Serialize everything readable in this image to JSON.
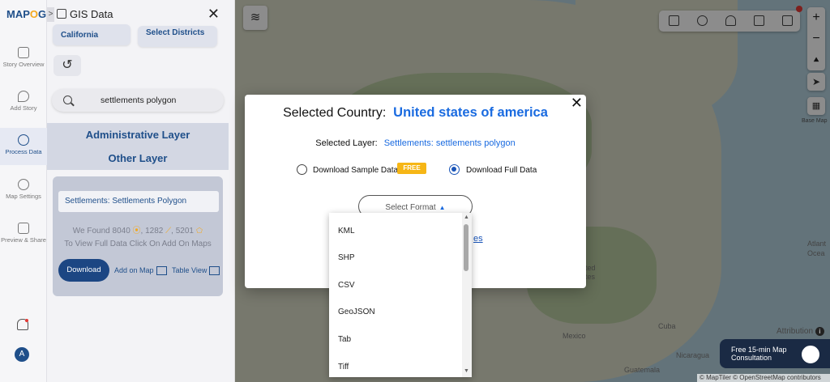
{
  "app": {
    "logo_left": "MAP",
    "logo_o": "O",
    "logo_right": "G",
    "panel_title": "GIS Data",
    "panel_toggle": ">",
    "close_glyph": "✕"
  },
  "rail": {
    "items": [
      {
        "label": "Story Overview",
        "icon": "book-icon"
      },
      {
        "label": "Add Story",
        "icon": "pin-icon"
      },
      {
        "label": "Process Data",
        "icon": "gear-icon"
      },
      {
        "label": "Map Settings",
        "icon": "settings-icon"
      },
      {
        "label": "Preview & Share",
        "icon": "share-icon"
      }
    ],
    "avatar": "A"
  },
  "panel": {
    "chip_state": "California",
    "chip_district": "Select Districts",
    "reset_glyph": "↺",
    "search_value": "settlements polygon",
    "layer_admin": "Administrative Layer",
    "layer_other": "Other Layer",
    "result_name": "Settlements: Settlements Polygon",
    "stats_a": "We Found  8040",
    "stats_b": "1282",
    "stats_c": "5201",
    "hint": "To View Full Data Click On Add On Maps",
    "download": "Download",
    "add_on_map": "Add on Map",
    "table_view": "Table View"
  },
  "map": {
    "labels": {
      "atlantic": "Atlant",
      "ocean": "Ocea",
      "mexico": "Mexico",
      "cuba": "Cuba",
      "guatemala": "Guatemala",
      "nicaragua": "Nicaragua",
      "united": "ted",
      "states": "tes"
    },
    "base_map": "Base Map",
    "attribution": "Attribution",
    "info_glyph": "i",
    "copyright": "© MapTiler © OpenStreetMap contributors",
    "consult_line1": "Free 15-min Map",
    "consult_line2": "Consultation",
    "zoom_in": "+",
    "zoom_out": "−"
  },
  "modal": {
    "title": "Selected Country:",
    "country": "United states of america",
    "layer_label": "Selected Layer:",
    "layer_value": "Settlements: settlements polygon",
    "opt_sample": "Download Sample Data",
    "free": "FREE",
    "opt_full": "Download Full Data",
    "format_placeholder": "Select Format",
    "format_caret": "▲",
    "link_partial": "es",
    "close_glyph": "✕"
  },
  "dropdown": {
    "items": [
      "KML",
      "SHP",
      "CSV",
      "GeoJSON",
      "Tab",
      "Tiff"
    ],
    "up": "▲",
    "down": "▼"
  }
}
